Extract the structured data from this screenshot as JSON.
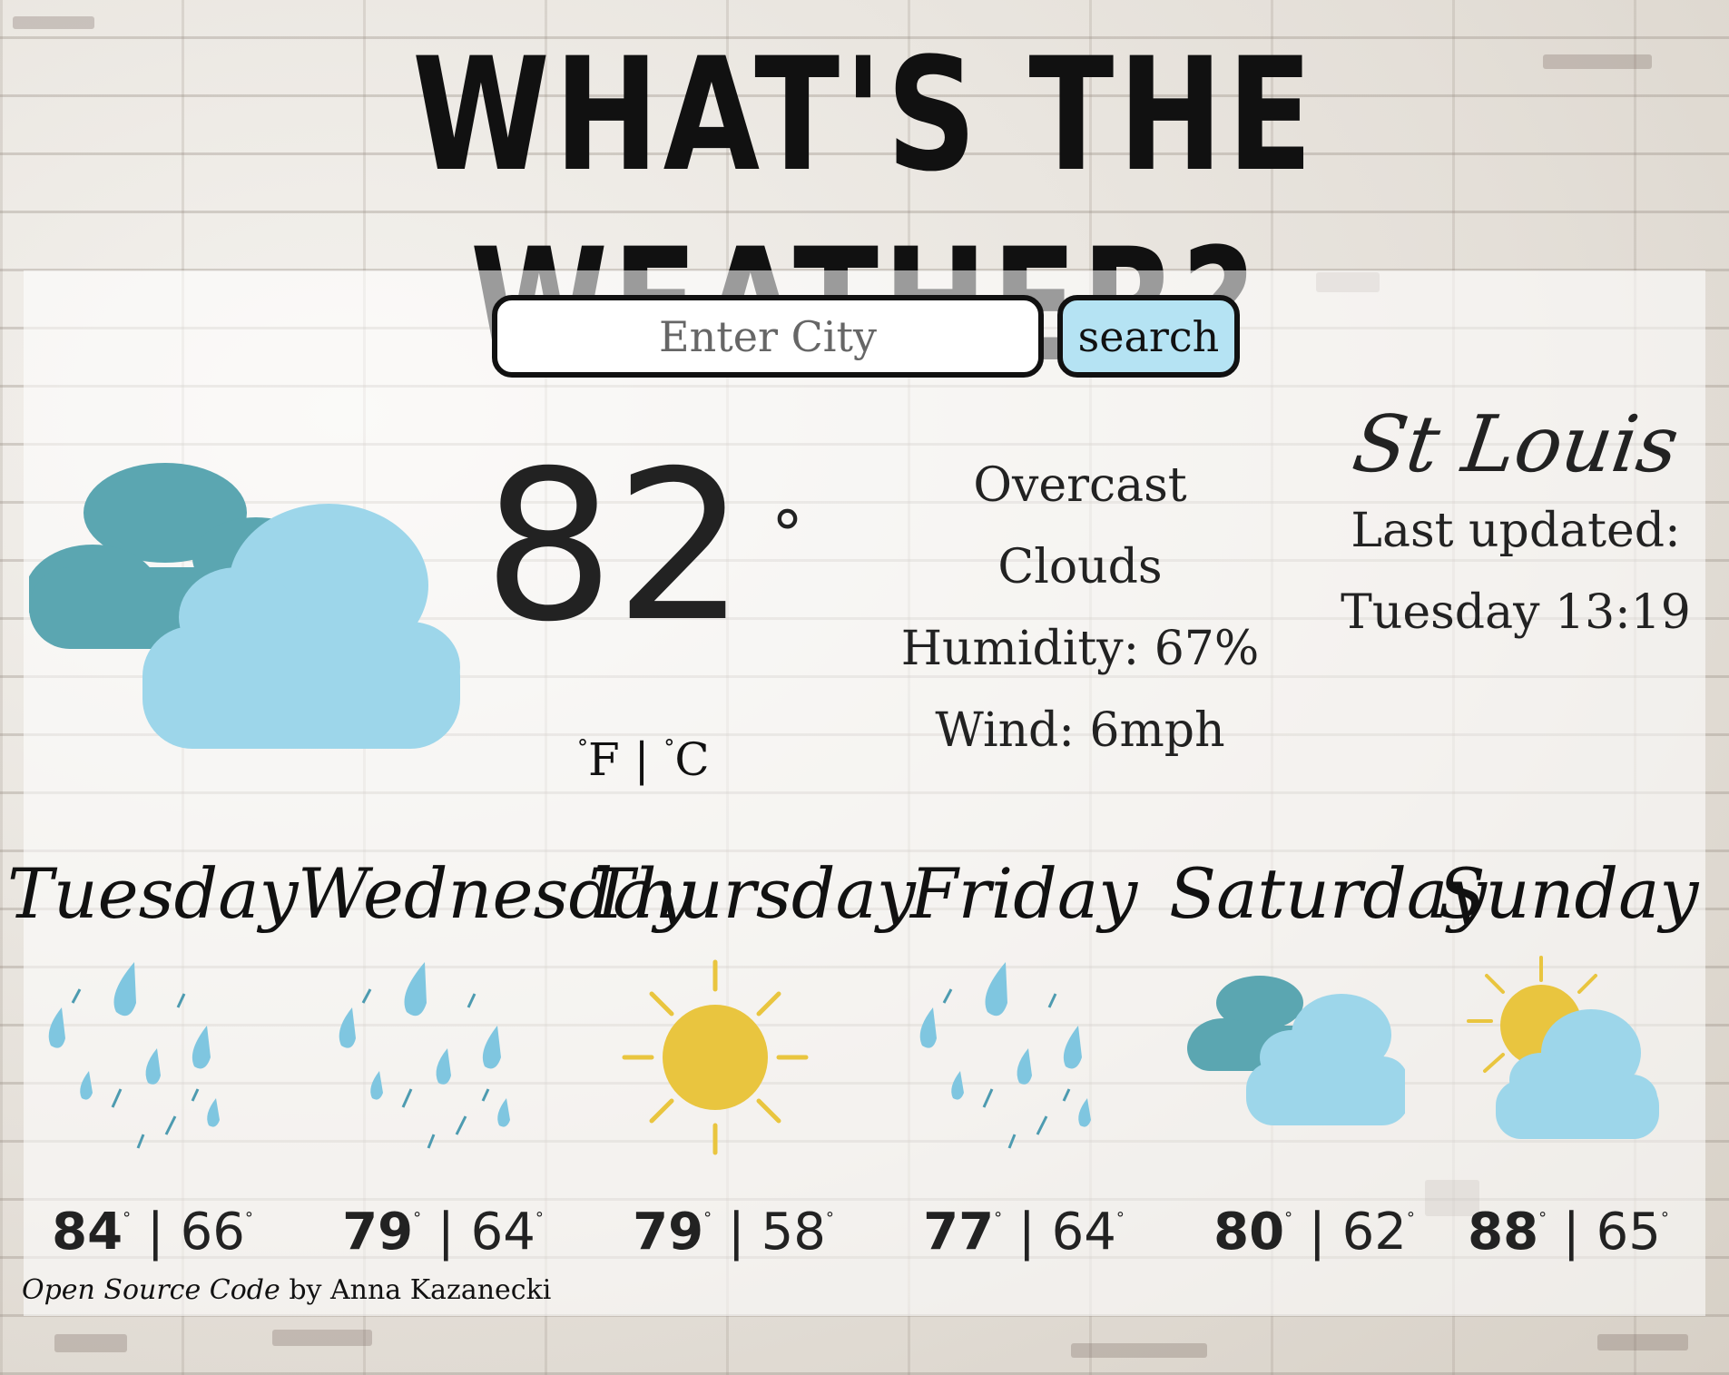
{
  "header": {
    "title": "WHAT'S THE WEATHER?"
  },
  "search": {
    "placeholder": "Enter City",
    "value": "",
    "button_label": "search"
  },
  "current": {
    "icon": "clouds-icon",
    "temperature": "82",
    "degree_symbol": "°",
    "units": {
      "fahrenheit": "F",
      "separator": "|",
      "celsius": "C",
      "degree": "°"
    },
    "description_line1": "Overcast",
    "description_line2": "Clouds",
    "humidity": "Humidity: 67%",
    "wind": "Wind: 6mph"
  },
  "location": {
    "city": "St Louis",
    "updated_label": "Last updated:",
    "updated_time": "Tuesday 13:19"
  },
  "forecast": [
    {
      "day": "Tuesday",
      "icon": "rain-icon",
      "high": "84",
      "low": "66"
    },
    {
      "day": "Wednesday",
      "icon": "rain-icon",
      "high": "79",
      "low": "64"
    },
    {
      "day": "Thursday",
      "icon": "sun-icon",
      "high": "79",
      "low": "58"
    },
    {
      "day": "Friday",
      "icon": "rain-icon",
      "high": "77",
      "low": "64"
    },
    {
      "day": "Saturday",
      "icon": "clouds-icon",
      "high": "80",
      "low": "62"
    },
    {
      "day": "Sunday",
      "icon": "partly-cloudy-icon",
      "high": "88",
      "low": "65"
    }
  ],
  "forecast_degree": "°",
  "forecast_separator": "|",
  "footer": {
    "link_text": "Open Source Code",
    "author_text": "by Anna Kazanecki"
  },
  "colors": {
    "dark_cloud": "#5ba6b1",
    "light_cloud": "#9dd6ea",
    "sun": "#e9c53f",
    "rain": "#7fc6e0",
    "button": "#b5e3f3"
  }
}
